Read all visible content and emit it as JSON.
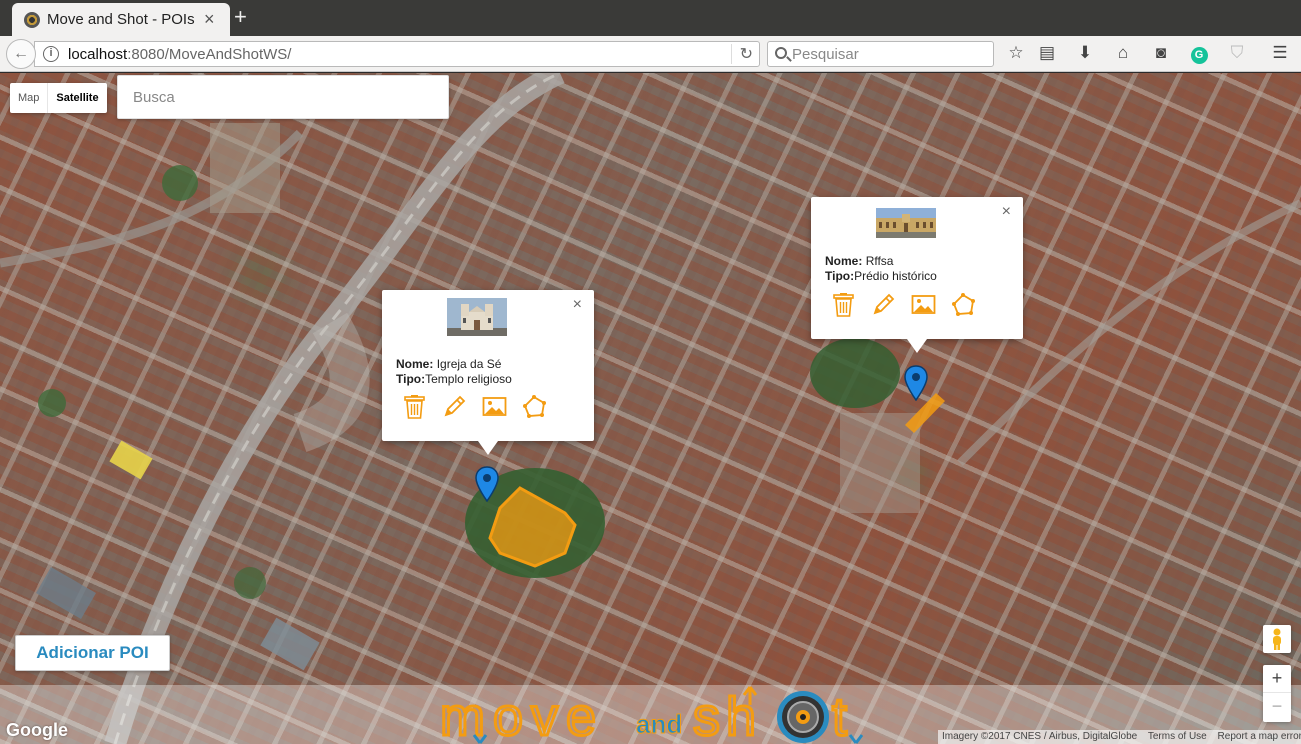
{
  "browser": {
    "tab_title": "Move and Shot - POIs",
    "new_tab": "+",
    "url_host": "localhost",
    "url_rest": ":8080/MoveAndShotWS/",
    "search_placeholder": "Pesquisar"
  },
  "map": {
    "type_options": [
      "Map",
      "Satellite"
    ],
    "active_type": "Satellite",
    "search_placeholder": "Busca",
    "zoom_in": "+",
    "zoom_out": "−",
    "add_poi_label": "Adicionar POI",
    "google_label": "Google",
    "attribution": "Imagery ©2017 CNES / Airbus, DigitalGlobe",
    "terms": "Terms of Use",
    "report": "Report a map error"
  },
  "popups": [
    {
      "name_label": "Nome:",
      "name_value": "Igreja da Sé",
      "type_label": "Tipo:",
      "type_value": "Templo religioso",
      "close": "×"
    },
    {
      "name_label": "Nome:",
      "name_value": "Rffsa",
      "type_label": "Tipo:",
      "type_value": "Prédio histórico",
      "close": "×"
    }
  ],
  "colors": {
    "accent": "#f39c12",
    "marker": "#1e88e5",
    "brand_blue": "#2a8bbf"
  },
  "logo": {
    "word1": "move",
    "word2": "and",
    "word3": "sh",
    "word4": "t"
  }
}
